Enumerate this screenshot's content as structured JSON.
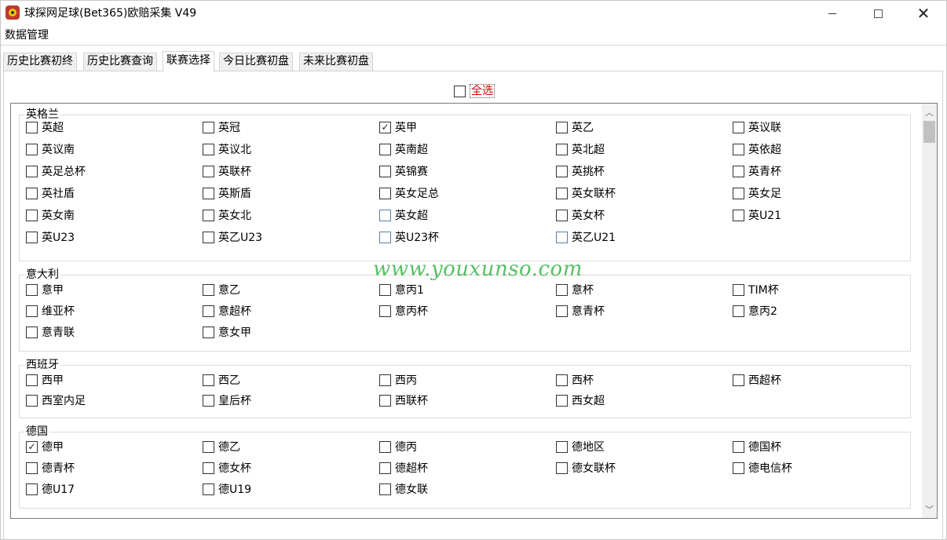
{
  "window": {
    "title": "球探网足球(Bet365)欧赔采集 V49",
    "buttons": {
      "minimize": "minimize",
      "maximize": "maximize",
      "close": "✕"
    }
  },
  "menu": {
    "items": [
      "数据管理"
    ]
  },
  "tabs": [
    {
      "label": "历史比赛初终",
      "active": false
    },
    {
      "label": "历史比赛查询",
      "active": false
    },
    {
      "label": "联赛选择",
      "active": true
    },
    {
      "label": "今日比赛初盘",
      "active": false
    },
    {
      "label": "未来比赛初盘",
      "active": false
    }
  ],
  "select_all": {
    "label": "全选",
    "checked": false
  },
  "groups": [
    {
      "title": "英格兰",
      "items": [
        {
          "label": "英超",
          "checked": false
        },
        {
          "label": "英冠",
          "checked": false
        },
        {
          "label": "英甲",
          "checked": true
        },
        {
          "label": "英乙",
          "checked": false
        },
        {
          "label": "英议联",
          "checked": false
        },
        {
          "label": "英议南",
          "checked": false
        },
        {
          "label": "英议北",
          "checked": false
        },
        {
          "label": "英南超",
          "checked": false
        },
        {
          "label": "英北超",
          "checked": false
        },
        {
          "label": "英依超",
          "checked": false
        },
        {
          "label": "英足总杯",
          "checked": false
        },
        {
          "label": "英联杯",
          "checked": false
        },
        {
          "label": "英锦赛",
          "checked": false
        },
        {
          "label": "英挑杯",
          "checked": false
        },
        {
          "label": "英青杯",
          "checked": false
        },
        {
          "label": "英社盾",
          "checked": false
        },
        {
          "label": "英斯盾",
          "checked": false
        },
        {
          "label": "英女足总",
          "checked": false
        },
        {
          "label": "英女联杯",
          "checked": false
        },
        {
          "label": "英女足",
          "checked": false
        },
        {
          "label": "英女南",
          "checked": false
        },
        {
          "label": "英女北",
          "checked": false
        },
        {
          "label": "英女超",
          "checked": false
        },
        {
          "label": "英女杯",
          "checked": false
        },
        {
          "label": "英U21",
          "checked": false
        },
        {
          "label": "英U23",
          "checked": false
        },
        {
          "label": "英乙U23",
          "checked": false
        },
        {
          "label": "英U23杯",
          "checked": false
        },
        {
          "label": "英乙U21",
          "checked": false
        }
      ]
    },
    {
      "title": "意大利",
      "items": [
        {
          "label": "意甲",
          "checked": false
        },
        {
          "label": "意乙",
          "checked": false
        },
        {
          "label": "意丙1",
          "checked": false
        },
        {
          "label": "意杯",
          "checked": false
        },
        {
          "label": "TIM杯",
          "checked": false
        },
        {
          "label": "维亚杯",
          "checked": false
        },
        {
          "label": "意超杯",
          "checked": false
        },
        {
          "label": "意丙杯",
          "checked": false
        },
        {
          "label": "意青杯",
          "checked": false
        },
        {
          "label": "意丙2",
          "checked": false
        },
        {
          "label": "意青联",
          "checked": false
        },
        {
          "label": "意女甲",
          "checked": false
        }
      ]
    },
    {
      "title": "西班牙",
      "items": [
        {
          "label": "西甲",
          "checked": false
        },
        {
          "label": "西乙",
          "checked": false
        },
        {
          "label": "西丙",
          "checked": false
        },
        {
          "label": "西杯",
          "checked": false
        },
        {
          "label": "西超杯",
          "checked": false
        },
        {
          "label": "西室内足",
          "checked": false
        },
        {
          "label": "皇后杯",
          "checked": false
        },
        {
          "label": "西联杯",
          "checked": false
        },
        {
          "label": "西女超",
          "checked": false
        }
      ]
    },
    {
      "title": "德国",
      "items": [
        {
          "label": "德甲",
          "checked": true
        },
        {
          "label": "德乙",
          "checked": false
        },
        {
          "label": "德丙",
          "checked": false
        },
        {
          "label": "德地区",
          "checked": false
        },
        {
          "label": "德国杯",
          "checked": false
        },
        {
          "label": "德青杯",
          "checked": false
        },
        {
          "label": "德女杯",
          "checked": false
        },
        {
          "label": "德超杯",
          "checked": false
        },
        {
          "label": "德女联杯",
          "checked": false
        },
        {
          "label": "德电信杯",
          "checked": false
        },
        {
          "label": "德U17",
          "checked": false
        },
        {
          "label": "德U19",
          "checked": false
        },
        {
          "label": "德女联",
          "checked": false
        }
      ]
    }
  ],
  "watermark": "www.youxunso.com",
  "colors": {
    "accent_red": "#e00000",
    "watermark_green": "#39b54a",
    "border": "#7a7a7a"
  }
}
